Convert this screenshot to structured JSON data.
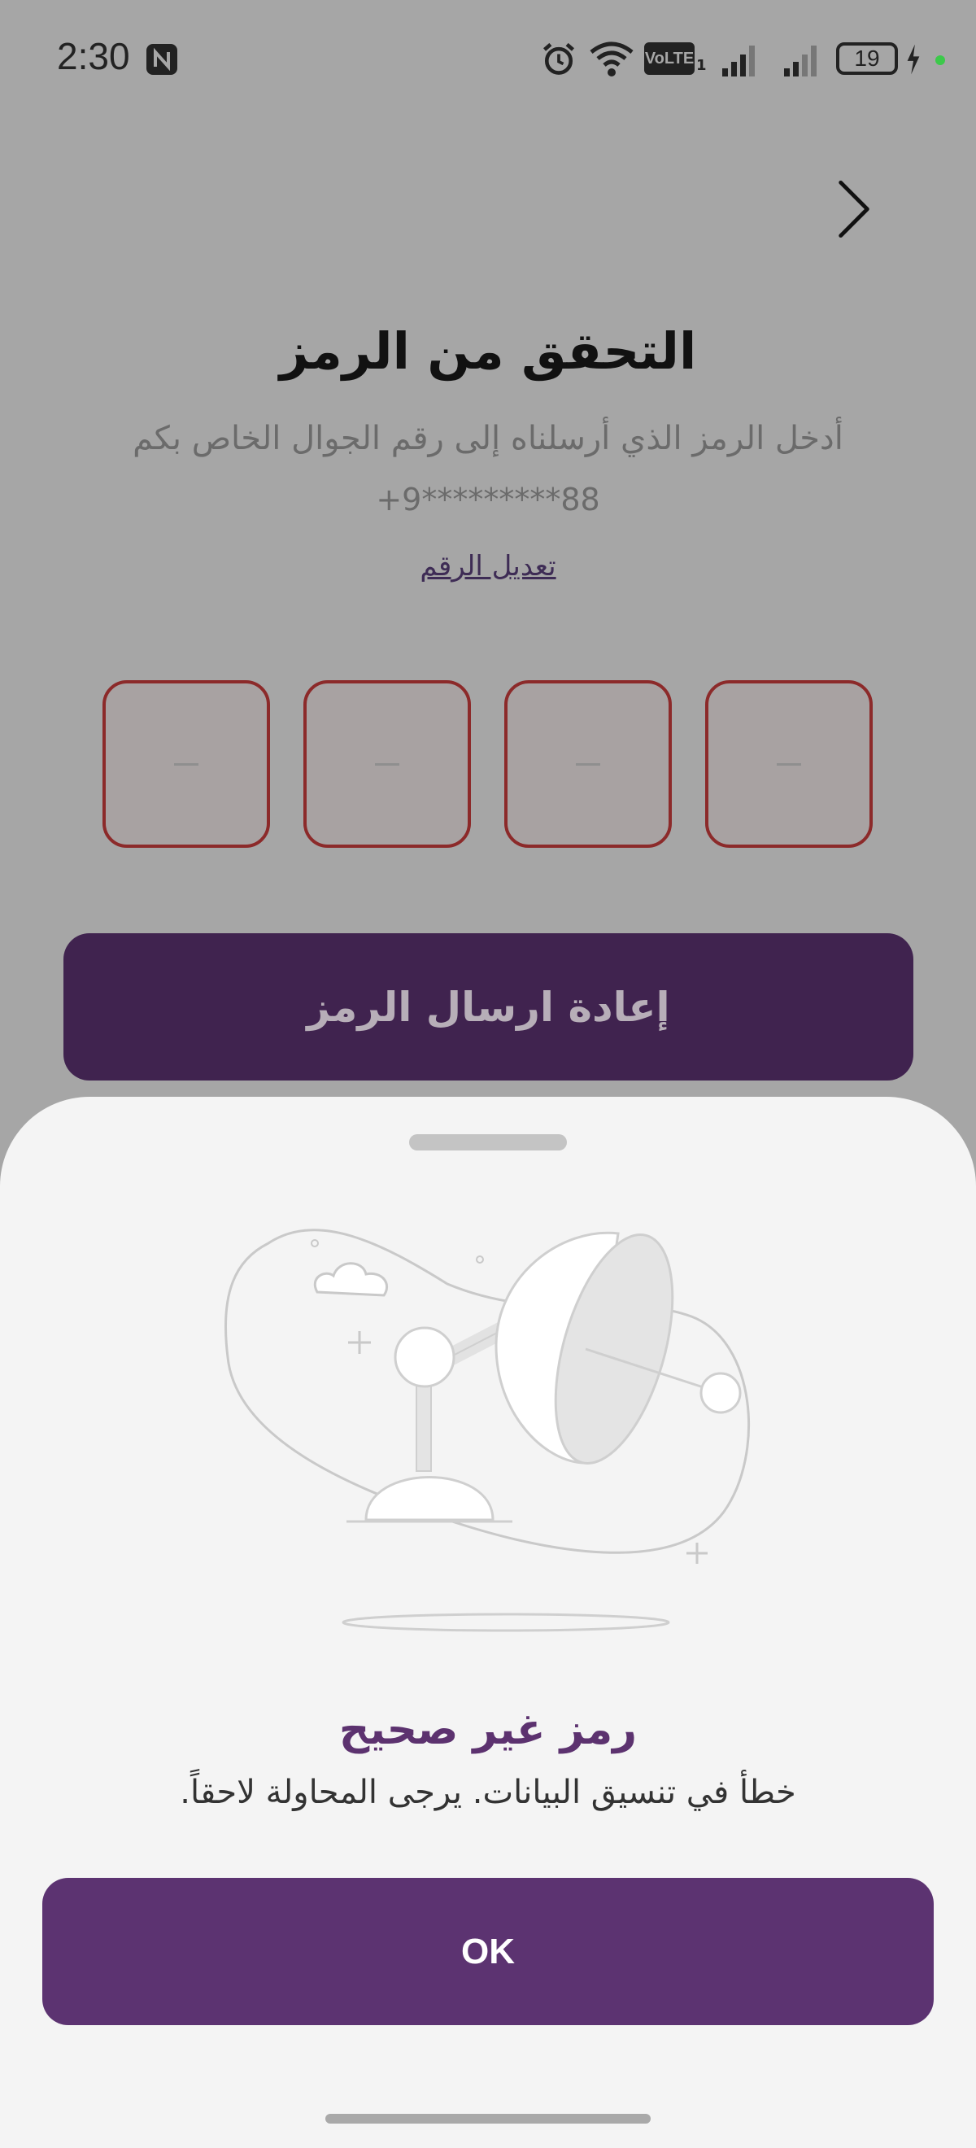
{
  "status_bar": {
    "time": "2:30",
    "battery_level": "19",
    "icons": [
      "nfc-icon",
      "alarm-icon",
      "wifi-icon",
      "volte-icon",
      "signal-icon",
      "signal-icon",
      "battery-icon",
      "charging-icon"
    ],
    "volte_label": "VoLTE",
    "sim_number": "1"
  },
  "header": {
    "title": "التحقق من الرمز",
    "subtitle": "أدخل الرمز الذي أرسلناه إلى رقم الجوال الخاص بكم",
    "masked_phone": "+9*********88",
    "edit_number_label": "تعديل الرقم"
  },
  "otp": {
    "placeholders": [
      "–",
      "–",
      "–",
      "–"
    ],
    "error_color": "#8c2a2a"
  },
  "resend_button": {
    "label": "إعادة ارسال الرمز"
  },
  "sheet": {
    "title": "رمز غير صحيح",
    "message": ".خطأ في تنسيق البيانات. يرجى المحاولة لاحقاً",
    "ok_label": "OK"
  },
  "colors": {
    "brand_purple": "#5c3371",
    "resend_purple": "#40234f",
    "title_purple": "#5c326f"
  }
}
